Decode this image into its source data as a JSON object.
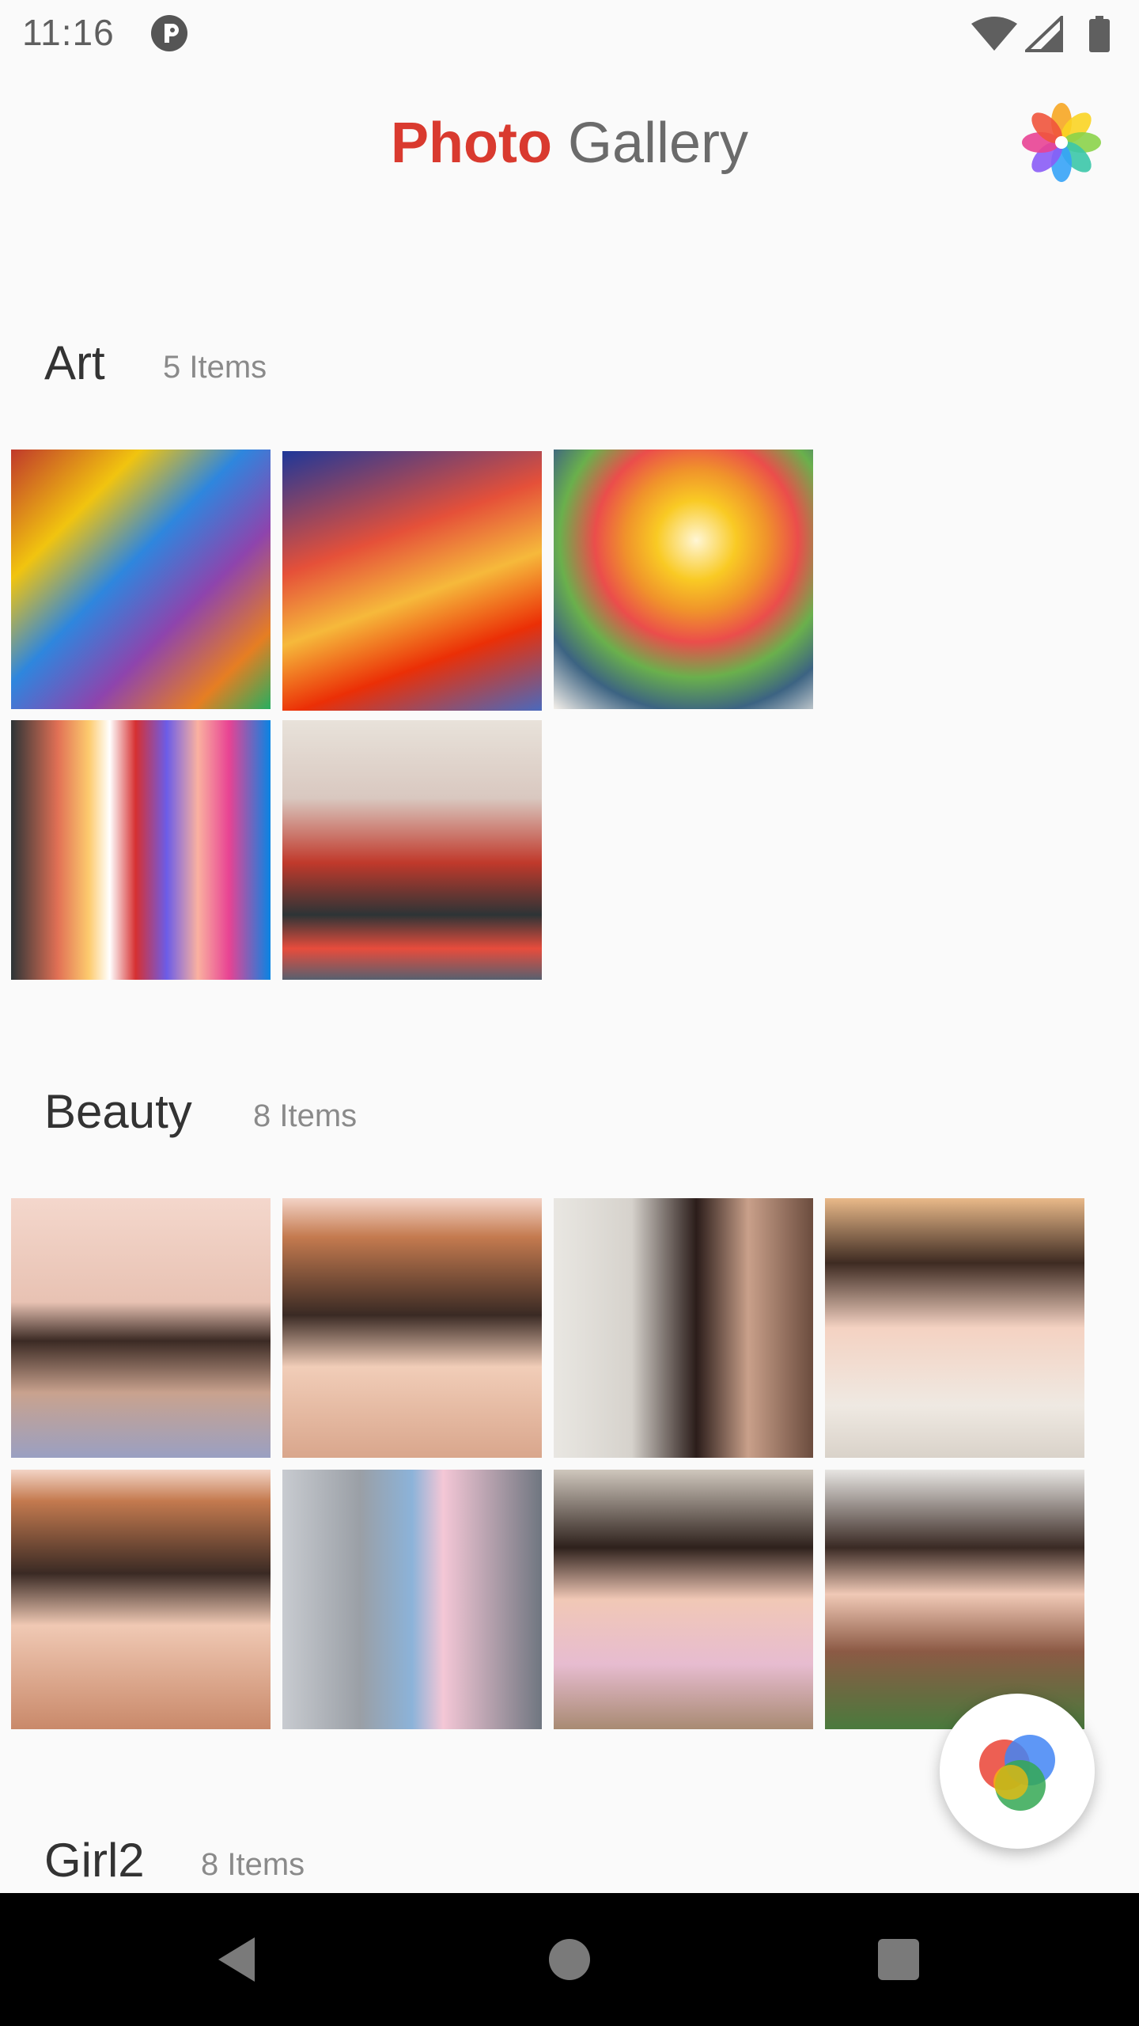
{
  "status": {
    "time": "11:16"
  },
  "header": {
    "title_part1": "Photo",
    "title_part2": " Gallery"
  },
  "sections": [
    {
      "title": "Art",
      "count": "5 Items"
    },
    {
      "title": "Beauty",
      "count": "8 Items"
    },
    {
      "title": "Girl2",
      "count": "8 Items"
    }
  ],
  "colors": {
    "title_accent": "#d93a2f",
    "background": "#fafafa",
    "nav_bar": "#000000"
  },
  "icons": [
    "app-status-icon",
    "wifi-icon",
    "signal-icon",
    "battery-icon",
    "gallery-logo-icon",
    "color-wheel-fab-icon",
    "back-icon",
    "home-icon",
    "recents-icon"
  ]
}
